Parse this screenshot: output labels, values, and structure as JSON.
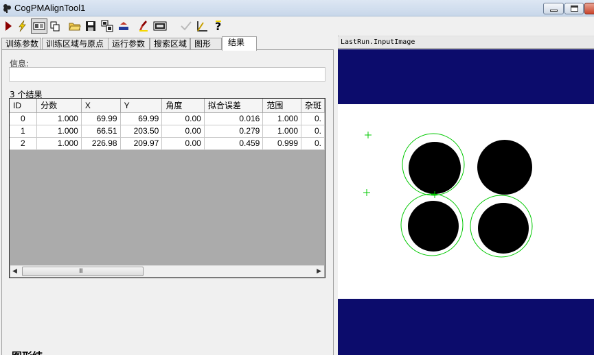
{
  "window": {
    "title": "CogPMAlignTool1"
  },
  "toolbar": {
    "icons": [
      "run-icon",
      "lightning-icon",
      "image-view-icon",
      "copy-icon",
      "open-folder-icon",
      "save-icon",
      "properties-icon",
      "reset-icon",
      "brush-icon",
      "number-display-icon",
      "checkmark-icon",
      "measure-icon",
      "help-icon"
    ]
  },
  "tabs": [
    "训练参数",
    "训练区域与原点",
    "运行参数",
    "搜索区域",
    "图形",
    "结果"
  ],
  "active_tab": "结果",
  "results": {
    "info_label": "信息:",
    "info_value": "",
    "count_label": "3 个结果",
    "columns": [
      "ID",
      "分数",
      "X",
      "Y",
      "角度",
      "拟合误差",
      "范围",
      "杂斑"
    ],
    "rows": [
      [
        "0",
        "1.000",
        "69.99",
        "69.99",
        "0.00",
        "0.016",
        "1.000",
        "0."
      ],
      [
        "1",
        "1.000",
        "66.51",
        "203.50",
        "0.00",
        "0.279",
        "1.000",
        "0."
      ],
      [
        "2",
        "1.000",
        "226.98",
        "209.97",
        "0.00",
        "0.459",
        "0.999",
        "0."
      ]
    ],
    "scroll_grip": "III"
  },
  "bottom_partial_text": "图形结",
  "viewer": {
    "title": "LastRun.InputImage",
    "colors": {
      "band": "#0c0c6c",
      "circle": "#000000",
      "overlay": "#00c800",
      "background": "#ffffff"
    }
  }
}
